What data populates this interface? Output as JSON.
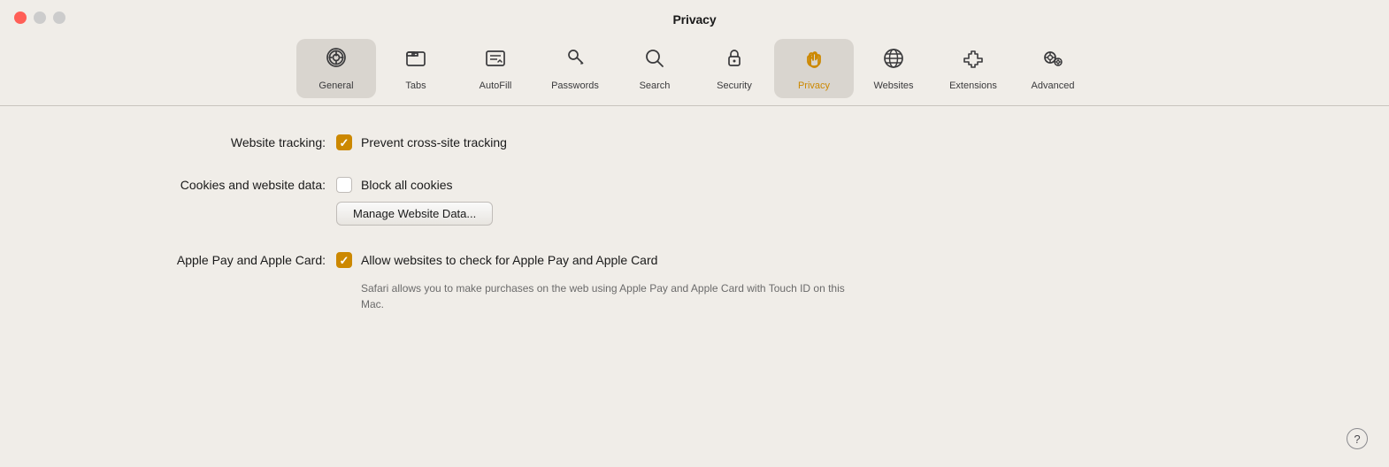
{
  "window": {
    "title": "Privacy",
    "controls": {
      "close_label": "close",
      "minimize_label": "minimize",
      "maximize_label": "maximize"
    }
  },
  "toolbar": {
    "items": [
      {
        "id": "general",
        "label": "General",
        "active": true
      },
      {
        "id": "tabs",
        "label": "Tabs",
        "active": false
      },
      {
        "id": "autofill",
        "label": "AutoFill",
        "active": false
      },
      {
        "id": "passwords",
        "label": "Passwords",
        "active": false
      },
      {
        "id": "search",
        "label": "Search",
        "active": false
      },
      {
        "id": "security",
        "label": "Security",
        "active": false
      },
      {
        "id": "privacy",
        "label": "Privacy",
        "active": false,
        "selected": true
      },
      {
        "id": "websites",
        "label": "Websites",
        "active": false
      },
      {
        "id": "extensions",
        "label": "Extensions",
        "active": false
      },
      {
        "id": "advanced",
        "label": "Advanced",
        "active": false
      }
    ]
  },
  "content": {
    "rows": [
      {
        "id": "website-tracking",
        "label": "Website tracking:",
        "checkbox_checked": true,
        "checkbox_label": "Prevent cross-site tracking"
      },
      {
        "id": "cookies",
        "label": "Cookies and website data:",
        "checkbox_checked": false,
        "checkbox_label": "Block all cookies",
        "button_label": "Manage Website Data..."
      },
      {
        "id": "apple-pay",
        "label": "Apple Pay and Apple Card:",
        "checkbox_checked": true,
        "checkbox_label": "Allow websites to check for Apple Pay and Apple Card",
        "description": "Safari allows you to make purchases on the web using Apple Pay and Apple Card with Touch ID on this Mac."
      }
    ]
  },
  "help": {
    "label": "?"
  }
}
